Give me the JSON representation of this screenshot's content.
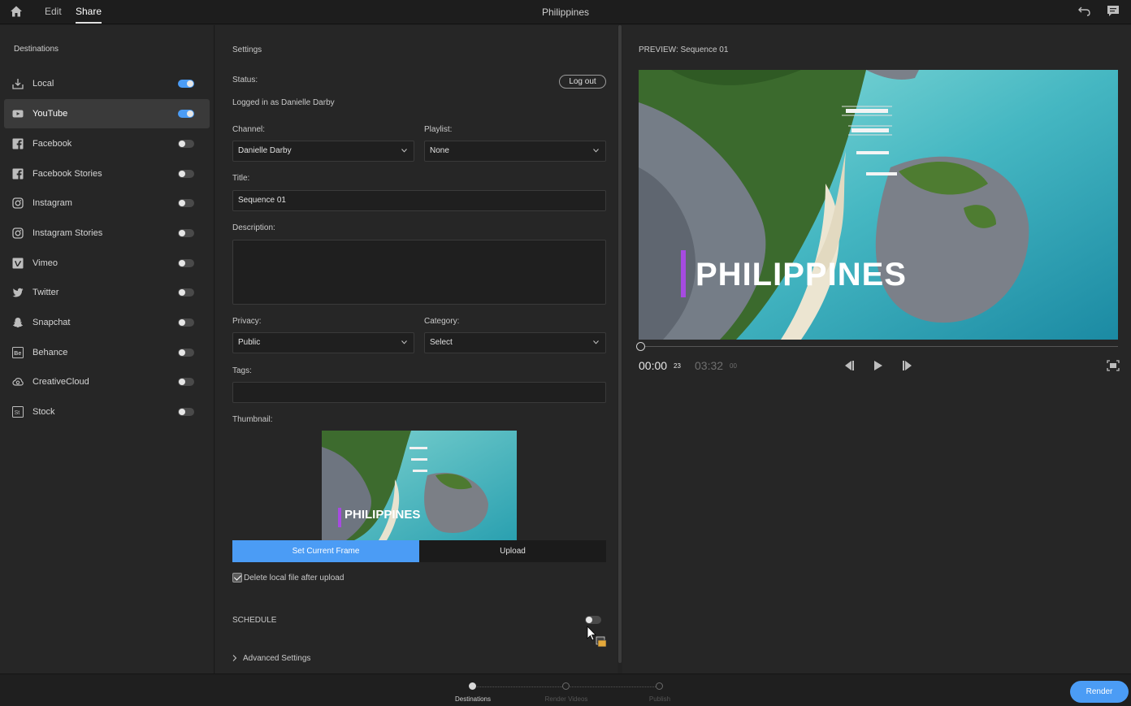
{
  "header": {
    "tabs": [
      {
        "label": "Edit"
      },
      {
        "label": "Share"
      }
    ],
    "title": "Philippines"
  },
  "destinations": {
    "heading": "Destinations",
    "items": [
      {
        "label": "Local",
        "enabled": true,
        "icon": "download-icon"
      },
      {
        "label": "YouTube",
        "enabled": true,
        "icon": "youtube-icon"
      },
      {
        "label": "Facebook",
        "enabled": false,
        "icon": "facebook-icon"
      },
      {
        "label": "Facebook Stories",
        "enabled": false,
        "icon": "facebook-icon"
      },
      {
        "label": "Instagram",
        "enabled": false,
        "icon": "instagram-icon"
      },
      {
        "label": "Instagram Stories",
        "enabled": false,
        "icon": "instagram-icon"
      },
      {
        "label": "Vimeo",
        "enabled": false,
        "icon": "vimeo-icon"
      },
      {
        "label": "Twitter",
        "enabled": false,
        "icon": "twitter-icon"
      },
      {
        "label": "Snapchat",
        "enabled": false,
        "icon": "snapchat-icon"
      },
      {
        "label": "Behance",
        "enabled": false,
        "icon": "behance-icon"
      },
      {
        "label": "CreativeCloud",
        "enabled": false,
        "icon": "creative-cloud-icon"
      },
      {
        "label": "Stock",
        "enabled": false,
        "icon": "stock-icon"
      }
    ]
  },
  "settings": {
    "heading": "Settings",
    "status_label": "Status:",
    "status_value": "Logged in as Danielle Darby",
    "logout_label": "Log out",
    "channel_label": "Channel:",
    "channel_value": "Danielle Darby",
    "playlist_label": "Playlist:",
    "playlist_value": "None",
    "title_label": "Title:",
    "title_value": "Sequence 01",
    "description_label": "Description:",
    "description_value": "",
    "privacy_label": "Privacy:",
    "privacy_value": "Public",
    "category_label": "Category:",
    "category_value": "Select",
    "tags_label": "Tags:",
    "tags_value": "",
    "thumbnail_label": "Thumbnail:",
    "thumbnail_overlay_text": "PHILIPPINES",
    "set_frame_label": "Set Current Frame",
    "upload_label": "Upload",
    "delete_local_label": "Delete local file after upload",
    "delete_local_checked": true,
    "schedule_label": "SCHEDULE",
    "schedule_enabled": false,
    "advanced_label": "Advanced Settings"
  },
  "preview": {
    "heading": "PREVIEW: Sequence 01",
    "overlay_text": "PHILIPPINES",
    "timecode_current": "00:00",
    "timecode_current_frames": "23",
    "timecode_total": "03:32",
    "timecode_total_frames": "00"
  },
  "footer": {
    "steps": [
      {
        "label": "Destinations",
        "active": true
      },
      {
        "label": "Render Videos",
        "active": false
      },
      {
        "label": "Publish",
        "active": false
      }
    ],
    "render_label": "Render"
  },
  "colors": {
    "accent": "#4b9cf5",
    "title_bar_accent": "#a64be0"
  }
}
